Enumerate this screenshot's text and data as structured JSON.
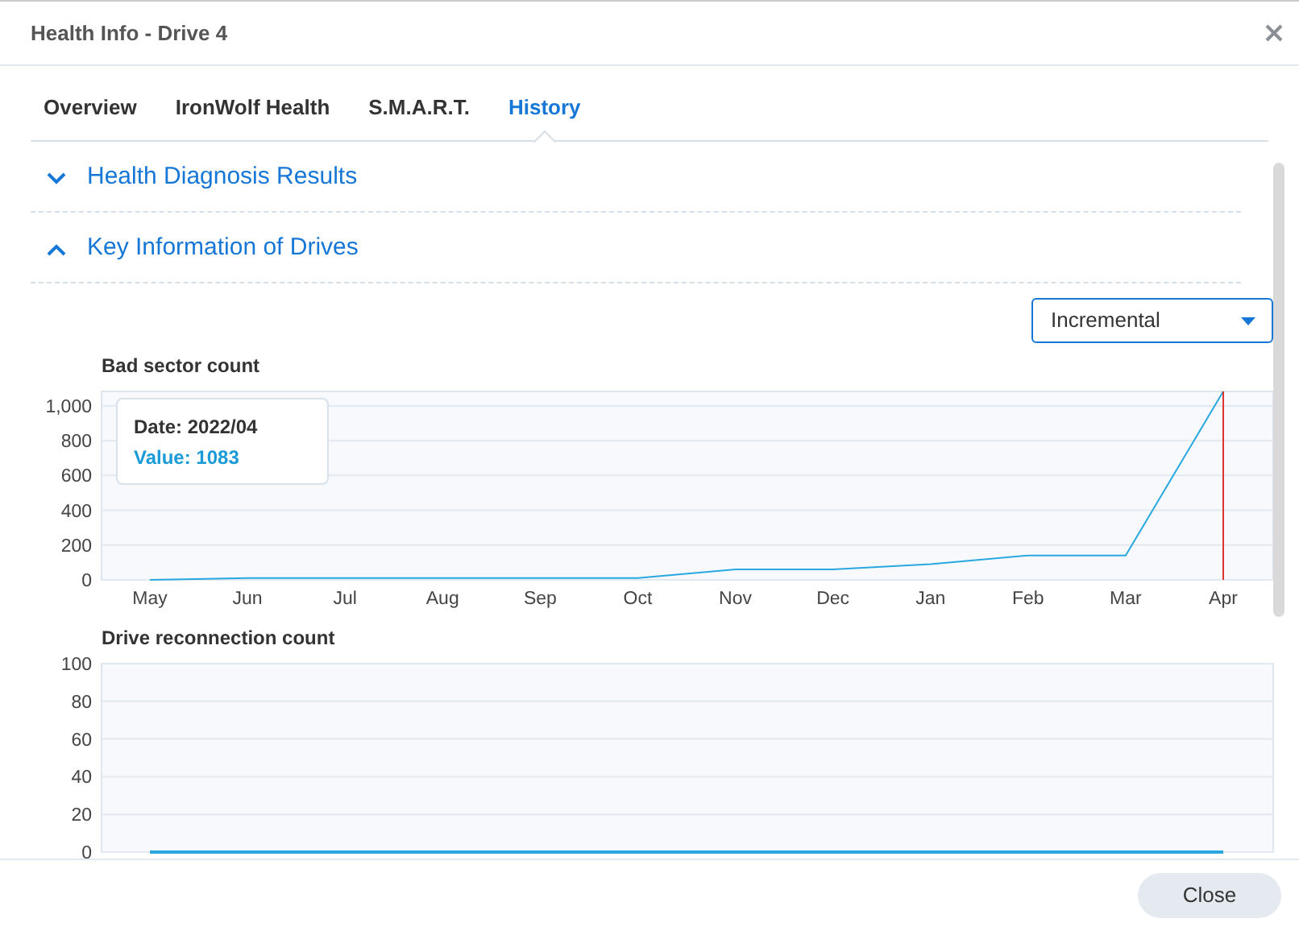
{
  "window": {
    "title": "Health Info - Drive 4"
  },
  "tabs": [
    {
      "label": "Overview",
      "selected": false
    },
    {
      "label": "IronWolf Health",
      "selected": false
    },
    {
      "label": "S.M.A.R.T.",
      "selected": false
    },
    {
      "label": "History",
      "selected": true
    }
  ],
  "sections": [
    {
      "title": "Health Diagnosis Results",
      "expanded": false
    },
    {
      "title": "Key Information of Drives",
      "expanded": true
    }
  ],
  "mode_select": {
    "value": "Incremental"
  },
  "charts": [
    {
      "chart_data": {
        "type": "line",
        "title": "Bad sector count",
        "categories": [
          "May",
          "Jun",
          "Jul",
          "Aug",
          "Sep",
          "Oct",
          "Nov",
          "Dec",
          "Jan",
          "Feb",
          "Mar",
          "Apr"
        ],
        "series": [
          {
            "color": "#29a8e0",
            "values": [
              0,
              10,
              10,
              10,
              10,
              10,
              60,
              60,
              90,
              140,
              140,
              1083
            ]
          }
        ],
        "ylim": [
          0,
          1083
        ],
        "grid": true,
        "ref_lines": [
          {
            "axis": "x",
            "value": "Apr",
            "color": "#dd3333"
          }
        ],
        "yticks": [
          0,
          200,
          400,
          600,
          800,
          {
            "value": 1000,
            "label": "1,000"
          }
        ]
      },
      "tooltip": {
        "date": "Date: 2022/04",
        "value": "Value: 1083"
      }
    },
    {
      "chart_data": {
        "type": "line",
        "title": "Drive reconnection count",
        "series": [
          {
            "color": "#29a8e0",
            "values": [
              0,
              0,
              0,
              0,
              0,
              0,
              0,
              0,
              0,
              0,
              0,
              0
            ]
          }
        ],
        "ylim": [
          0,
          100
        ],
        "grid": true,
        "yticks": [
          0,
          20,
          40,
          60,
          80,
          100
        ]
      }
    }
  ],
  "buttons": [
    {
      "label": "Close"
    }
  ]
}
